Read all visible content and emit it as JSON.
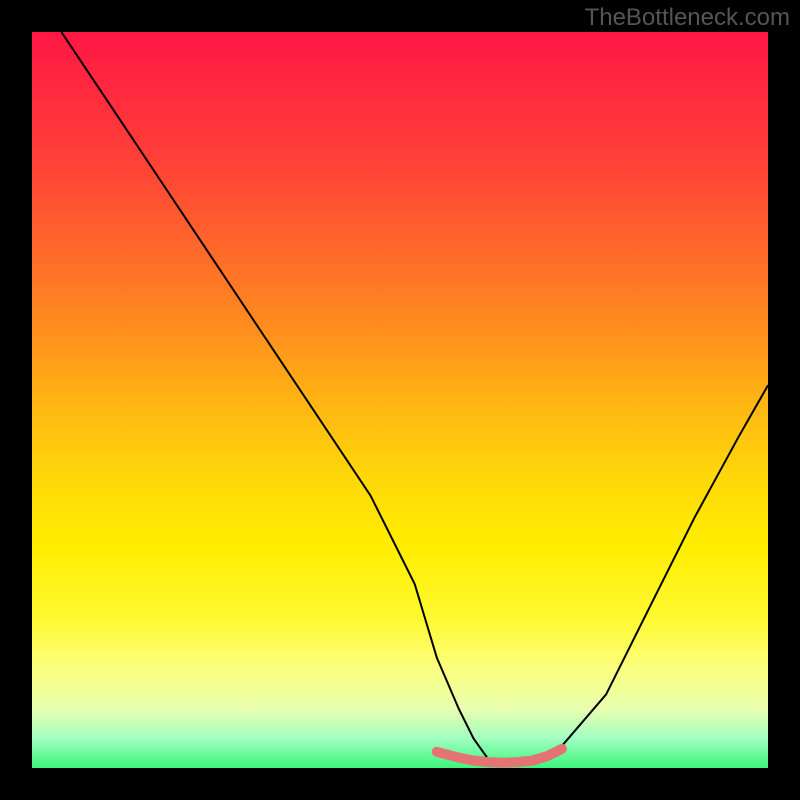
{
  "watermark": "TheBottleneck.com",
  "chart_data": {
    "type": "line",
    "title": "",
    "xlabel": "",
    "ylabel": "",
    "xlim": [
      0,
      100
    ],
    "ylim": [
      0,
      100
    ],
    "background_gradient": {
      "top_color": "#ff1744",
      "bottom_color": "#3cf57c",
      "description": "red-orange-yellow-green vertical gradient"
    },
    "series": [
      {
        "name": "main-curve",
        "color": "#000000",
        "stroke_width": 2,
        "x": [
          4,
          10,
          16,
          22,
          28,
          34,
          40,
          46,
          52,
          55,
          58,
          60,
          62,
          64,
          66,
          68,
          72,
          78,
          84,
          90,
          96,
          100
        ],
        "values": [
          100,
          91,
          82,
          73,
          64,
          55,
          46,
          37,
          25,
          15,
          8,
          4,
          1.2,
          0.8,
          0.7,
          0.8,
          3,
          10,
          22,
          34,
          45,
          52
        ]
      },
      {
        "name": "highlight-segment",
        "color": "#e57373",
        "stroke_width": 10,
        "x": [
          55,
          58,
          60,
          62,
          64,
          66,
          68,
          70,
          72
        ],
        "values": [
          2.2,
          1.4,
          1.0,
          0.8,
          0.7,
          0.8,
          1.0,
          1.6,
          2.6
        ]
      }
    ]
  }
}
